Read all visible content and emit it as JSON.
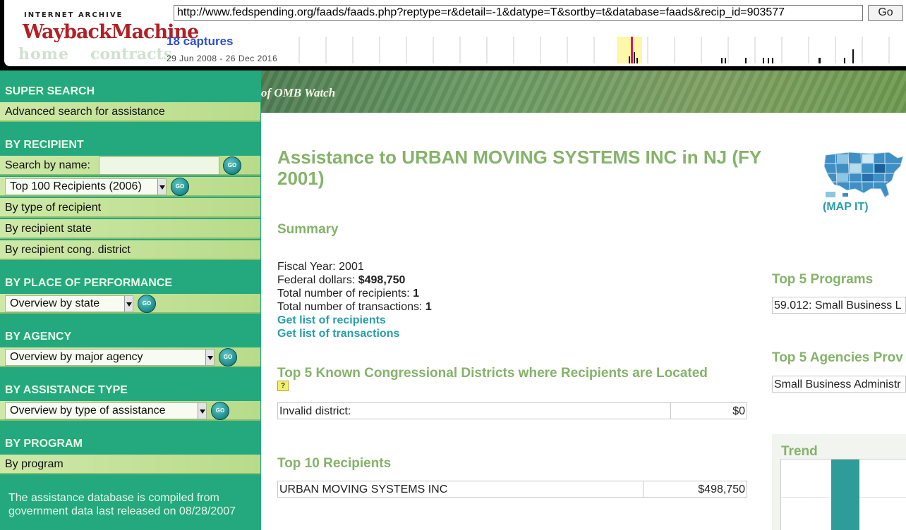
{
  "wayback": {
    "logo_top": "INTERNET ARCHIVE",
    "logo_main": "WaybackMachine",
    "url": "http://www.fedspending.org/faads/faads.php?reptype=r&detail=-1&datype=T&sortby=t&database=faads&recip_id=903577",
    "go_label": "Go",
    "captures": "18 captures",
    "date_range": "29 Jun 2008 - 26 Dec 2016",
    "ghost_tabs": [
      "home",
      "contracts"
    ]
  },
  "banner": {
    "text": "of OMB Watch"
  },
  "sidebar": {
    "super_search": {
      "heading": "SUPER SEARCH",
      "link": "Advanced search for assistance"
    },
    "by_recipient": {
      "heading": "BY RECIPIENT",
      "search_label": "Search by name:",
      "search_value": "",
      "select_value": "Top 100 Recipients (2006)",
      "links": [
        "By type of recipient",
        "By recipient state",
        "By recipient cong. district"
      ]
    },
    "by_place": {
      "heading": "BY PLACE OF PERFORMANCE",
      "select_value": "Overview by state"
    },
    "by_agency": {
      "heading": "BY AGENCY",
      "select_value": "Overview by major agency"
    },
    "by_assistance": {
      "heading": "BY ASSISTANCE TYPE",
      "select_value": "Overview by type of assistance"
    },
    "by_program": {
      "heading": "BY PROGRAM",
      "link": "By program"
    },
    "go_label": "GO",
    "note": "The assistance database is compiled from government data last released on 08/28/2007"
  },
  "main": {
    "title": "Assistance to URBAN MOVING SYSTEMS INC in NJ (FY 2001)",
    "summary_heading": "Summary",
    "fiscal_year": "Fiscal Year: 2001",
    "federal_label": "Federal dollars: ",
    "federal_value": "$498,750",
    "recipients_label": "Total number of recipients: ",
    "recipients_value": "1",
    "transactions_label": "Total number of transactions: ",
    "transactions_value": "1",
    "link_recipients": "Get list of recipients",
    "link_transactions": "Get list of transactions",
    "districts_heading": "Top 5 Known Congressional Districts where Recipients are Located",
    "help_icon": "?",
    "districts": [
      {
        "name": "Invalid district:",
        "amount": "$0"
      }
    ],
    "recipients_heading": "Top 10 Recipients",
    "recipients": [
      {
        "name": "URBAN MOVING SYSTEMS INC",
        "amount": "$498,750"
      }
    ]
  },
  "right": {
    "map_link": "(MAP IT)",
    "programs_heading": "Top 5 Programs",
    "programs": [
      "59.012: Small Business L"
    ],
    "agencies_heading": "Top 5 Agencies Prov",
    "agencies": [
      "Small Business Administr"
    ],
    "trend_heading": "Trend"
  },
  "colors": {
    "sidebar_bg": "#23a97d",
    "heading_green": "#85b36a",
    "link_teal": "#2a9ea8",
    "trend_bar": "#2e9c99"
  }
}
